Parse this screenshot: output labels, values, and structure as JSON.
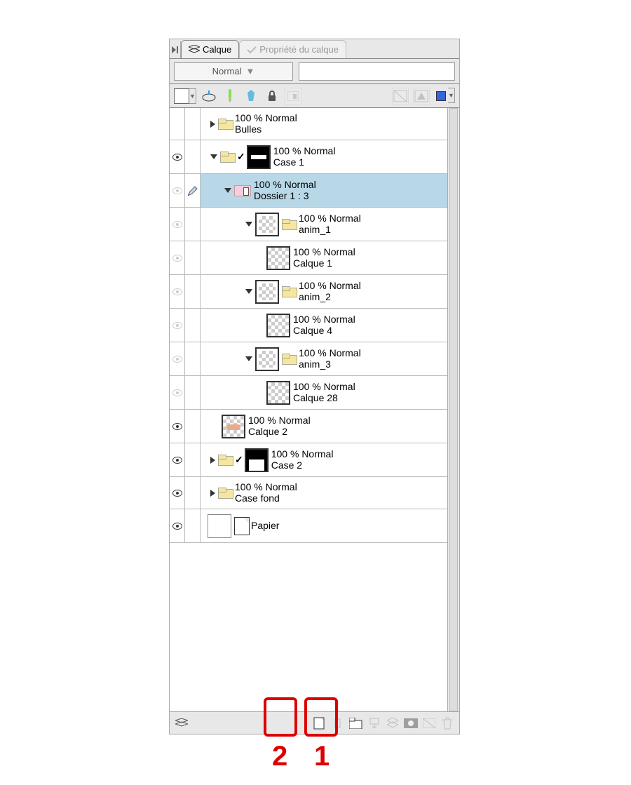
{
  "tabs": {
    "active": "Calque",
    "inactive": "Propriété du calque"
  },
  "blend_mode": "Normal",
  "layers": [
    {
      "opacity": "100 % Normal",
      "name": "Bulles"
    },
    {
      "opacity": "100 % Normal",
      "name": "Case 1"
    },
    {
      "opacity": "100 % Normal",
      "name": "Dossier 1 : 3"
    },
    {
      "opacity": "100 % Normal",
      "name": "anim_1"
    },
    {
      "opacity": "100 % Normal",
      "name": "Calque 1"
    },
    {
      "opacity": "100 % Normal",
      "name": "anim_2"
    },
    {
      "opacity": "100 % Normal",
      "name": "Calque 4"
    },
    {
      "opacity": "100 % Normal",
      "name": "anim_3"
    },
    {
      "opacity": "100 % Normal",
      "name": "Calque 28"
    },
    {
      "opacity": "100 % Normal",
      "name": "Calque 2"
    },
    {
      "opacity": "100 % Normal",
      "name": "Case 2"
    },
    {
      "opacity": "100 % Normal",
      "name": "Case fond"
    },
    {
      "opacity": "",
      "name": "Papier"
    }
  ],
  "annotations": {
    "box2": "2",
    "box1": "1"
  }
}
